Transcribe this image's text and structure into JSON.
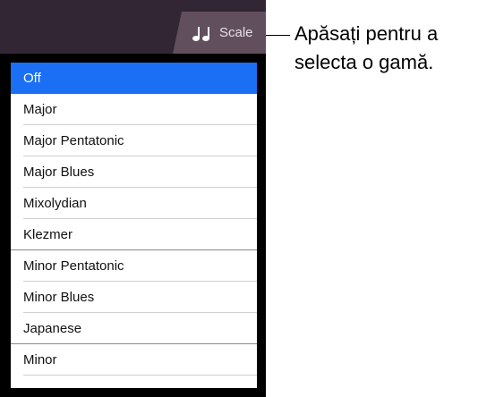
{
  "toolbar": {
    "scale_tab": {
      "label": "Scale",
      "icon": "music-notes-icon"
    }
  },
  "menu": {
    "items": [
      {
        "label": "Off",
        "selected": true
      },
      {
        "label": "Major"
      },
      {
        "label": "Major Pentatonic"
      },
      {
        "label": "Major Blues"
      },
      {
        "label": "Mixolydian"
      },
      {
        "label": "Klezmer"
      },
      {
        "label": "Minor Pentatonic"
      },
      {
        "label": "Minor Blues"
      },
      {
        "label": "Japanese"
      },
      {
        "label": "Minor"
      }
    ]
  },
  "callout": {
    "line1": "Apăsați pentru a",
    "line2": "selecta o gamă."
  },
  "colors": {
    "top_bar": "#332634",
    "scale_tab": "#614f5d",
    "selected_item": "#1a6ff5",
    "app_background": "#000000"
  }
}
